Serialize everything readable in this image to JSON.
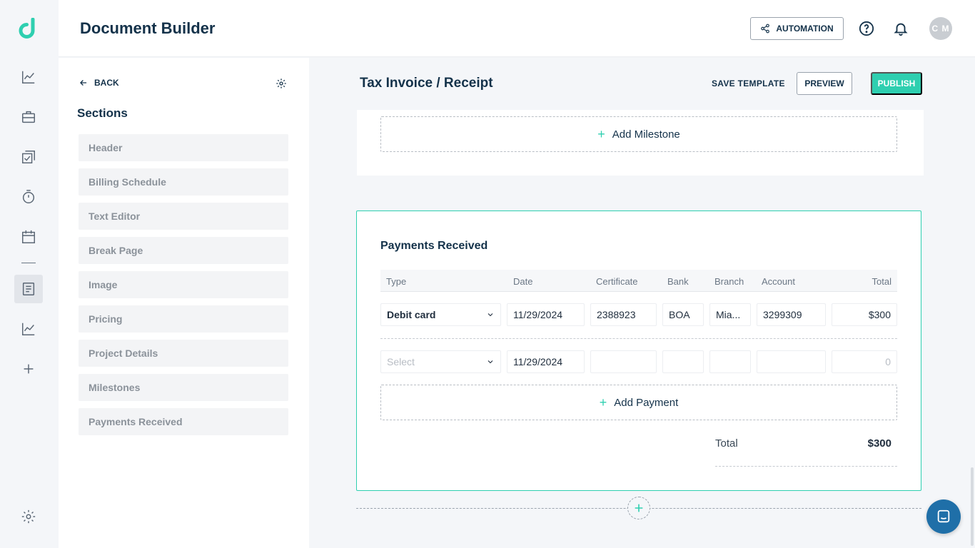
{
  "app": {
    "title": "Document Builder"
  },
  "header": {
    "automation_label": "AUTOMATION",
    "avatar_initials": "C M"
  },
  "rail": {
    "icons": [
      "logo-icon",
      "analytics-icon",
      "briefcase-icon",
      "tasks-icon",
      "timer-icon",
      "calendar-icon",
      "documents-icon",
      "reports-icon",
      "add-icon",
      "settings-icon"
    ],
    "active": "documents-icon"
  },
  "panel": {
    "back_label": "BACK",
    "sections_title": "Sections",
    "sections": [
      {
        "label": "Header"
      },
      {
        "label": "Billing Schedule"
      },
      {
        "label": "Text Editor"
      },
      {
        "label": "Break Page"
      },
      {
        "label": "Image"
      },
      {
        "label": "Pricing"
      },
      {
        "label": "Project Details"
      },
      {
        "label": "Milestones"
      },
      {
        "label": "Payments Received"
      }
    ]
  },
  "document": {
    "title": "Tax Invoice / Receipt",
    "save_template_label": "SAVE TEMPLATE",
    "preview_label": "PREVIEW",
    "publish_label": "PUBLISH",
    "add_milestone_label": "Add Milestone"
  },
  "payments": {
    "title": "Payments Received",
    "columns": [
      "Type",
      "Date",
      "Certificate",
      "Bank",
      "Branch",
      "Account",
      "Total"
    ],
    "rows": [
      {
        "type": "Debit card",
        "date": "11/29/2024",
        "certificate": "2388923",
        "bank": "BOA",
        "branch": "Mia...",
        "account": "3299309",
        "total": "$300"
      }
    ],
    "new_row": {
      "type_placeholder": "Select",
      "date": "11/29/2024",
      "total_placeholder": "0"
    },
    "add_payment_label": "Add Payment",
    "total_label": "Total",
    "total_value": "$300"
  },
  "colors": {
    "accent": "#2ecfb0",
    "brand_dark": "#14324a",
    "chat_button": "#1f6fa8"
  }
}
